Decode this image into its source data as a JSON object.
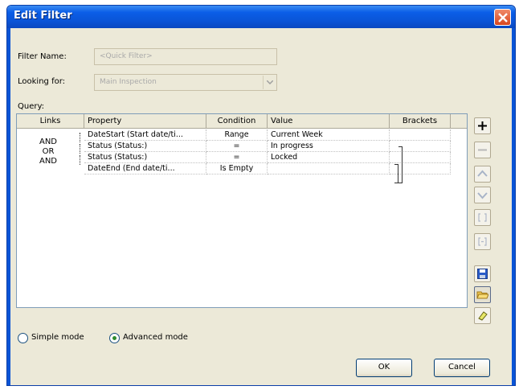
{
  "window": {
    "title": "Edit Filter"
  },
  "form": {
    "filter_name_label": "Filter Name:",
    "filter_name_value": "<Quick Filter>",
    "looking_for_label": "Looking for:",
    "looking_for_value": "Main Inspection",
    "query_label": "Query:"
  },
  "grid": {
    "headers": [
      "Links",
      "Property",
      "Condition",
      "Value",
      "Brackets"
    ],
    "links": [
      "AND",
      "OR",
      "AND"
    ],
    "rows": [
      {
        "property": "DateStart (Start date/ti...",
        "condition": "Range",
        "value": "Current Week"
      },
      {
        "property": "Status (Status:)",
        "condition": "=",
        "value": "In progress"
      },
      {
        "property": "Status (Status:)",
        "condition": "=",
        "value": "Locked"
      },
      {
        "property": "DateEnd (End date/ti...",
        "condition": "Is Empty",
        "value": ""
      }
    ]
  },
  "toolbar": {
    "icons": [
      "add-icon",
      "remove-icon",
      "move-up-icon",
      "move-down-icon",
      "add-bracket-icon",
      "remove-bracket-icon",
      "save-icon",
      "open-folder-icon",
      "clear-icon"
    ]
  },
  "mode": {
    "simple_label": "Simple mode",
    "advanced_label": "Advanced mode",
    "selected": "advanced"
  },
  "buttons": {
    "ok": "OK",
    "cancel": "Cancel"
  },
  "colors": {
    "titlebar": "#0a54d6",
    "close": "#d9461e",
    "dialog_bg": "#ece9d8"
  }
}
